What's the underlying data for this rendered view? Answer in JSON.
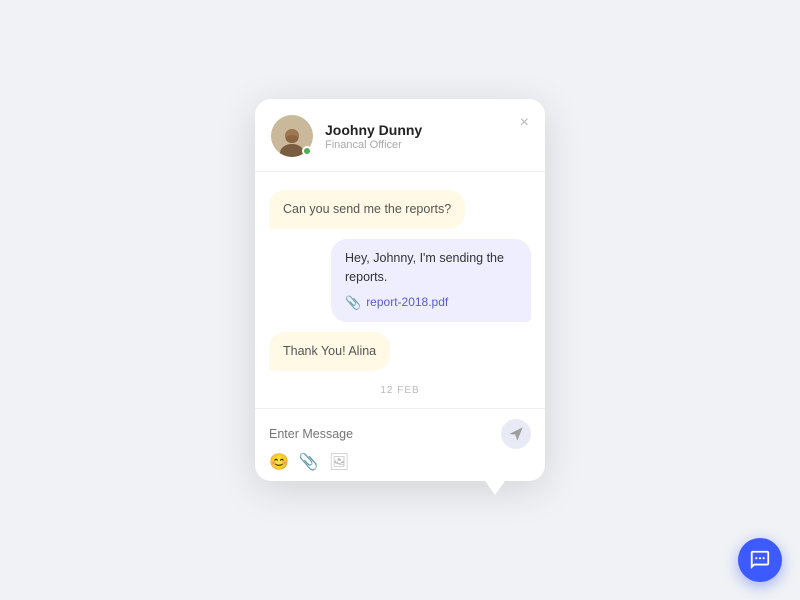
{
  "header": {
    "name": "Joohny Dunny",
    "role": "Financal Officer",
    "close_label": "×",
    "status": "online"
  },
  "messages": [
    {
      "id": 1,
      "side": "left",
      "text": "Can you send me the reports?",
      "attachment": null
    },
    {
      "id": 2,
      "side": "right",
      "text": "Hey, Johnny, I'm sending the reports.",
      "attachment": {
        "icon": "📎",
        "filename": "report-2018.pdf"
      }
    },
    {
      "id": 3,
      "side": "left",
      "text": "Thank You! Alina",
      "attachment": null
    }
  ],
  "date_divider": "12 FEB",
  "input": {
    "placeholder": "Enter Message"
  },
  "toolbar": {
    "emoji_icon": "😊",
    "attach_icon": "📎",
    "image_icon": "🖼"
  },
  "float_button": {
    "label": "chat"
  },
  "colors": {
    "accent": "#3d5afe",
    "bubble_left_bg": "#fff9e6",
    "bubble_right_bg": "#eeeeff",
    "online": "#4caf50"
  }
}
